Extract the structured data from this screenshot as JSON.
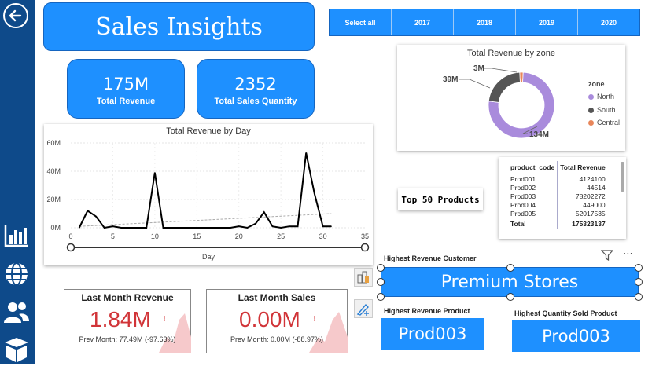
{
  "app": {
    "title": "Sales Insights"
  },
  "sidebar": {
    "items": [
      {
        "icon": "back-arrow-icon"
      },
      {
        "icon": "bar-chart-icon"
      },
      {
        "icon": "globe-icon"
      },
      {
        "icon": "users-icon"
      },
      {
        "icon": "box-icon"
      }
    ]
  },
  "kpis": [
    {
      "value": "175M",
      "label": "Total Revenue"
    },
    {
      "value": "2352",
      "label": "Total Sales Quantity"
    }
  ],
  "year_slicer": {
    "options": [
      "Select all",
      "2017",
      "2018",
      "2019",
      "2020"
    ]
  },
  "donut": {
    "title": "Total Revenue by zone",
    "legend_title": "zone",
    "labels": [
      "3M",
      "39M",
      "134M"
    ]
  },
  "line_chart": {
    "title": "Total Revenue by Day",
    "xlabel": "Day",
    "yticks": [
      "60M",
      "40M",
      "20M",
      "0M"
    ],
    "xticks": [
      "0",
      "5",
      "10",
      "15",
      "20",
      "25",
      "30",
      "35"
    ]
  },
  "chart_data": [
    {
      "type": "pie",
      "title": "Total Revenue by zone",
      "legend_placement": "right",
      "categories": [
        "North",
        "South",
        "Central"
      ],
      "values": [
        134,
        39,
        3
      ],
      "unit": "M",
      "colors": [
        "#a98bdc",
        "#555555",
        "#e8865a"
      ]
    },
    {
      "type": "line",
      "title": "Total Revenue by Day",
      "xlabel": "Day",
      "ylabel": "",
      "xlim": [
        0,
        35
      ],
      "ylim": [
        0,
        60
      ],
      "trendline": true,
      "x": [
        1,
        2,
        3,
        4,
        5,
        6,
        7,
        8,
        9,
        10,
        11,
        12,
        13,
        14,
        15,
        16,
        17,
        18,
        19,
        20,
        21,
        22,
        23,
        24,
        25,
        26,
        27,
        28,
        29,
        30,
        31
      ],
      "series": [
        {
          "values": [
            0,
            12,
            8,
            0,
            1,
            0,
            0,
            0,
            0,
            39,
            0,
            0,
            0,
            0,
            0,
            0,
            0,
            0,
            0,
            1,
            0,
            3,
            11,
            1,
            0,
            1,
            1,
            53,
            24,
            1,
            1
          ]
        }
      ]
    }
  ],
  "top50_label": "Top 50 Products",
  "products_table": {
    "columns": [
      "product_code",
      "Total Revenue"
    ],
    "rows": [
      [
        "Prod001",
        "4124100"
      ],
      [
        "Prod002",
        "44514"
      ],
      [
        "Prod003",
        "78202272"
      ],
      [
        "Prod004",
        "449000"
      ],
      [
        "Prod005",
        "52017535"
      ]
    ],
    "total": [
      "Total",
      "175323137"
    ]
  },
  "highest_revenue_customer": {
    "label": "Highest Revenue Customer",
    "value": "Premium Stores"
  },
  "highest_revenue_product": {
    "label": "Highest Revenue Product",
    "value": "Prod003"
  },
  "highest_quantity_product": {
    "label": "Highest Quantity Sold Product",
    "value": "Prod003"
  },
  "last_month_revenue": {
    "title": "Last Month Revenue",
    "value": "1.84M",
    "sub": "Prev Month: 77.49M (-97.63%)"
  },
  "last_month_sales": {
    "title": "Last Month Sales",
    "value": "0.00M",
    "sub": "Prev Month: 0.00M (-88.97%)"
  },
  "colors": {
    "accent": "#1e90ff",
    "sidebar": "#0e4a8a",
    "negative": "#d13438"
  }
}
